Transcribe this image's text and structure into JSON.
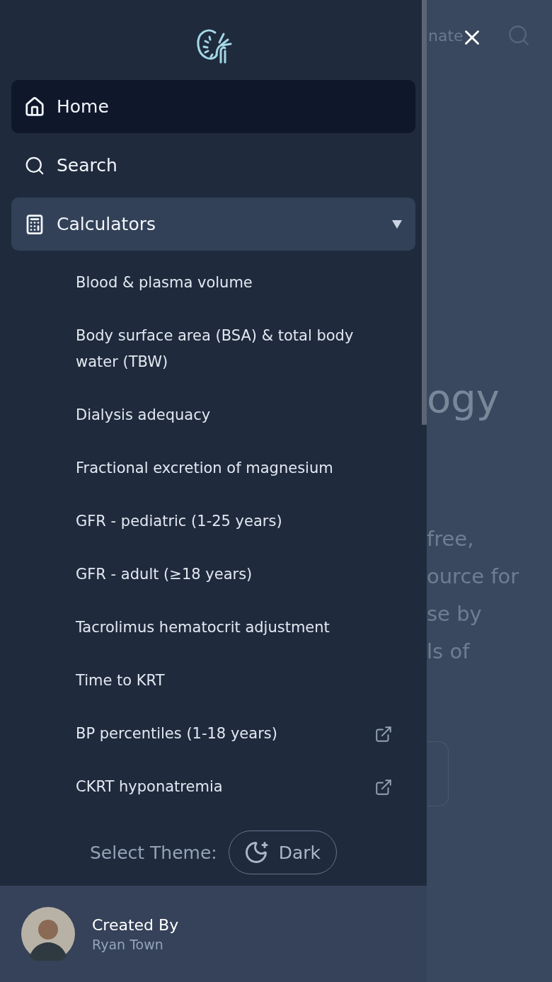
{
  "background": {
    "tab": "nate",
    "heading": "ogy",
    "lines": [
      "free,",
      "ource for",
      "se by",
      "ls of"
    ]
  },
  "nav": [
    {
      "label": "Home",
      "kind": "home",
      "selected": true,
      "expanded": false
    },
    {
      "label": "Search",
      "kind": "search",
      "selected": false,
      "expanded": false
    },
    {
      "label": "Calculators",
      "kind": "calculator",
      "selected": false,
      "expanded": true,
      "children": [
        {
          "label": "Blood & plasma volume",
          "external": false
        },
        {
          "label": "Body surface area (BSA) & total body water (TBW)",
          "external": false
        },
        {
          "label": "Dialysis adequacy",
          "external": false
        },
        {
          "label": "Fractional excretion of magnesium",
          "external": false
        },
        {
          "label": "GFR - pediatric (1-25 years)",
          "external": false
        },
        {
          "label": "GFR - adult (≥18 years)",
          "external": false
        },
        {
          "label": "Tacrolimus hematocrit adjustment",
          "external": false
        },
        {
          "label": "Time to KRT",
          "external": false
        },
        {
          "label": "BP percentiles (1-18 years)",
          "external": true
        },
        {
          "label": "CKRT hyponatremia",
          "external": true
        }
      ]
    }
  ],
  "theme": {
    "label": "Select Theme:",
    "value": "Dark"
  },
  "creator": {
    "title": "Created By",
    "name": "Ryan Town"
  }
}
